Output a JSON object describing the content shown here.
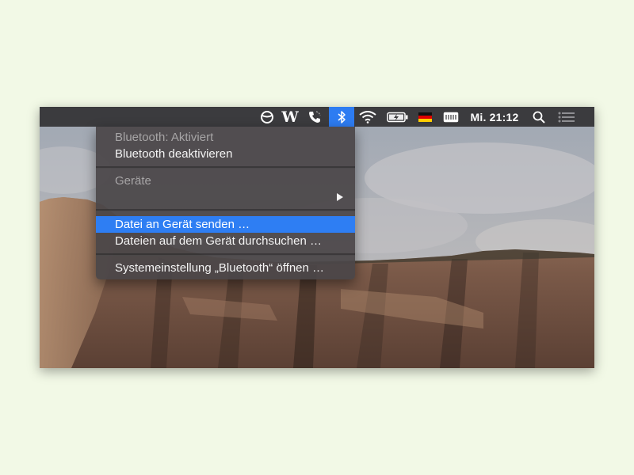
{
  "menubar": {
    "clock": "Mi. 21:12",
    "w_label": "W",
    "icons": [
      "status-circle-icon",
      "w-app-icon",
      "phone-icon",
      "bluetooth-icon",
      "wifi-icon",
      "battery-charging-icon",
      "german-flag-icon",
      "keyboard-icon",
      "spotlight-search-icon",
      "notification-center-icon"
    ]
  },
  "bluetooth_menu": {
    "status": "Bluetooth: Aktiviert",
    "toggle": "Bluetooth deaktivieren",
    "devices_header": "Geräte",
    "send_file": "Datei an Gerät senden …",
    "browse_files": "Dateien auf dem Gerät durchsuchen …",
    "open_prefs": "Systemeinstellung „Bluetooth“ öffnen …"
  },
  "colors": {
    "menubar": "#3b3b3e",
    "highlight": "#2e7ef3",
    "page_background": "#f2f9e6"
  }
}
